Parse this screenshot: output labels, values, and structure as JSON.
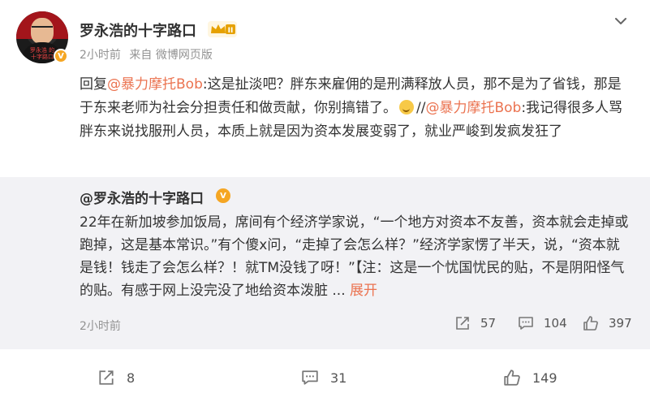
{
  "post": {
    "author": "罗永浩的十字路口",
    "time": "2小时前",
    "source": "来自 微博网页版",
    "reply_prefix": "回复",
    "mention1": "@暴力摩托Bob",
    "text1": ":这是扯淡吧？胖东来雇佣的是刑满释放人员，那不是为了省钱，那是于东来老师为社会分担责任和做贡献，你别搞错了。",
    "separator": "//",
    "mention2": "@暴力摩托Bob",
    "text2": ":我记得很多人骂胖东来说找服刑人员，本质上就是因为资本发展变弱了，就业严峻到发疯发狂了",
    "avatar_text": "罗永浩 的十字路口",
    "crown_level": "II"
  },
  "quote": {
    "author": "@罗永浩的十字路口",
    "text": "22年在新加坡参加饭局，席间有个经济学家说，“一个地方对资本不友善，资本就会走掉或跑掉，这是基本常识。”有个傻x问，“走掉了会怎么样？”经济学家愣了半天，说，“资本就是钱！钱走了会怎么样？！就TM没钱了呀！”【注：这是一个忧国忧民的贴，不是阴阳怪气的贴。有感于网上没完没了地给资本泼脏",
    "ellipsis": " ... ",
    "expand": "展开",
    "time": "2小时前",
    "reposts": "57",
    "comments": "104",
    "likes": "397"
  },
  "actions": {
    "reposts": "8",
    "comments": "31",
    "likes": "149"
  },
  "colors": {
    "accent": "#eb7350",
    "badge": "#f5a623",
    "quote_bg": "#f2f2f5",
    "meta": "#939393"
  },
  "icons": [
    "more-chevron-icon",
    "repost-icon",
    "comment-icon",
    "like-icon",
    "verified-icon",
    "crown-icon"
  ]
}
